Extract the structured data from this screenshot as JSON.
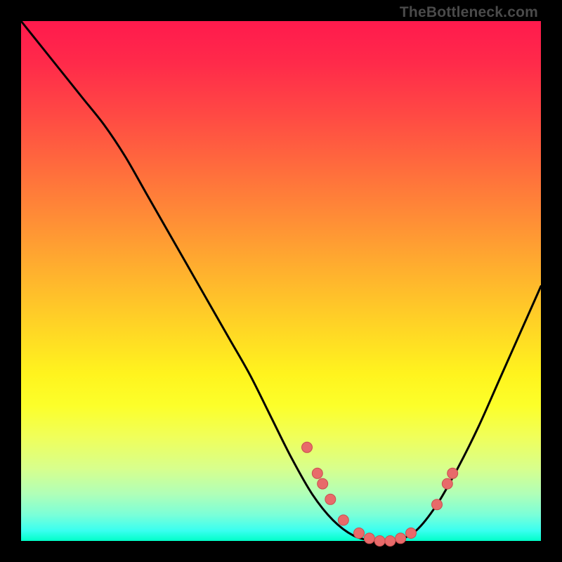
{
  "watermark": "TheBottleneck.com",
  "colors": {
    "background": "#000000",
    "curve": "#000000",
    "marker_fill": "#e86a6a",
    "marker_stroke": "#c94f4f"
  },
  "chart_data": {
    "type": "line",
    "title": "",
    "xlabel": "",
    "ylabel": "",
    "xlim": [
      0,
      100
    ],
    "ylim": [
      0,
      100
    ],
    "grid": false,
    "series": [
      {
        "name": "bottleneck-curve",
        "x": [
          0,
          4,
          8,
          12,
          16,
          20,
          24,
          28,
          32,
          36,
          40,
          44,
          48,
          52,
          56,
          60,
          64,
          68,
          72,
          76,
          80,
          84,
          88,
          92,
          96,
          100
        ],
        "values": [
          100,
          95,
          90,
          85,
          80,
          74,
          67,
          60,
          53,
          46,
          39,
          32,
          24,
          16,
          9,
          4,
          1,
          0,
          0,
          2,
          7,
          14,
          22,
          31,
          40,
          49
        ]
      }
    ],
    "markers": {
      "name": "highlight-points",
      "x": [
        55,
        57,
        58,
        59.5,
        62,
        65,
        67,
        69,
        71,
        73,
        75,
        80,
        82,
        83
      ],
      "values": [
        18,
        13,
        11,
        8,
        4,
        1.5,
        0.5,
        0,
        0,
        0.5,
        1.5,
        7,
        11,
        13
      ]
    }
  }
}
